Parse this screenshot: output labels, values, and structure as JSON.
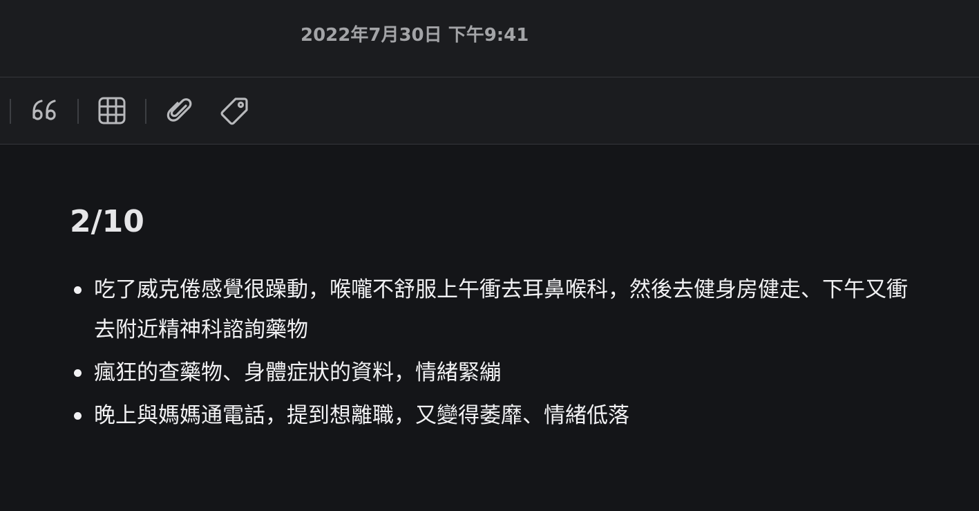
{
  "header": {
    "timestamp": "2022年7月30日 下午9:41"
  },
  "toolbar": {
    "buttons": [
      {
        "icon": "quote-icon",
        "label": "Quote"
      },
      {
        "icon": "table-icon",
        "label": "Table"
      },
      {
        "icon": "paperclip-icon",
        "label": "Attachment"
      },
      {
        "icon": "tag-icon",
        "label": "Tag"
      }
    ],
    "icon_color": "#b8b9bc"
  },
  "note": {
    "title": "2/10",
    "items": [
      "吃了威克倦感覺很躁動，喉嚨不舒服上午衝去耳鼻喉科，然後去健身房健走、下午又衝去附近精神科諮詢藥物",
      "瘋狂的查藥物、身體症狀的資料，情緒緊繃",
      "晚上與媽媽通電話，提到想離職，又變得萎靡、情緒低落"
    ]
  },
  "colors": {
    "background": "#141518",
    "header_background": "#1b1c1f",
    "divider": "#35373b",
    "text_primary": "#f1f1f3",
    "text_secondary": "#a3a4a7"
  }
}
